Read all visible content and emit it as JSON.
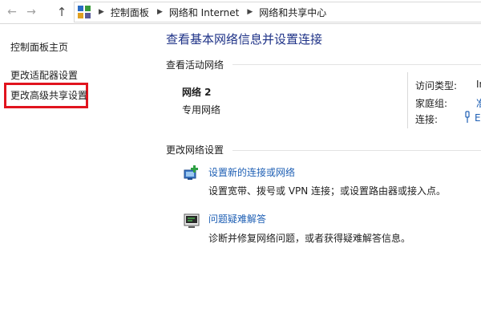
{
  "address_bar": {
    "back_icon": "arrow-left-icon",
    "forward_icon": "arrow-right-icon",
    "up_icon": "arrow-up-icon",
    "location_icon": "control-panel-icon",
    "crumbs": [
      "控制面板",
      "网络和 Internet",
      "网络和共享中心"
    ]
  },
  "sidebar": {
    "items": [
      {
        "label": "控制面板主页"
      },
      {
        "label": "更改适配器设置"
      },
      {
        "label": "更改高级共享设置"
      }
    ]
  },
  "main": {
    "title": "查看基本网络信息并设置连接",
    "active_networks_label": "查看活动网络",
    "network": {
      "name": "网络  2",
      "type": "专用网络",
      "props": [
        {
          "label": "访问类型:",
          "value": "In"
        },
        {
          "label": "家庭组:",
          "value": "准"
        },
        {
          "label": "连接:",
          "value": "E"
        }
      ]
    },
    "change_settings_label": "更改网络设置",
    "tasks": [
      {
        "link": "设置新的连接或网络",
        "desc": "设置宽带、拨号或 VPN 连接；或设置路由器或接入点。",
        "icon": "new-connection-icon"
      },
      {
        "link": "问题疑难解答",
        "desc": "诊断并修复网络问题，或者获得疑难解答信息。",
        "icon": "troubleshoot-icon"
      }
    ]
  },
  "colors": {
    "title_blue": "#1e3287",
    "link_blue": "#1e5fb4",
    "highlight_red": "#e1141e"
  }
}
